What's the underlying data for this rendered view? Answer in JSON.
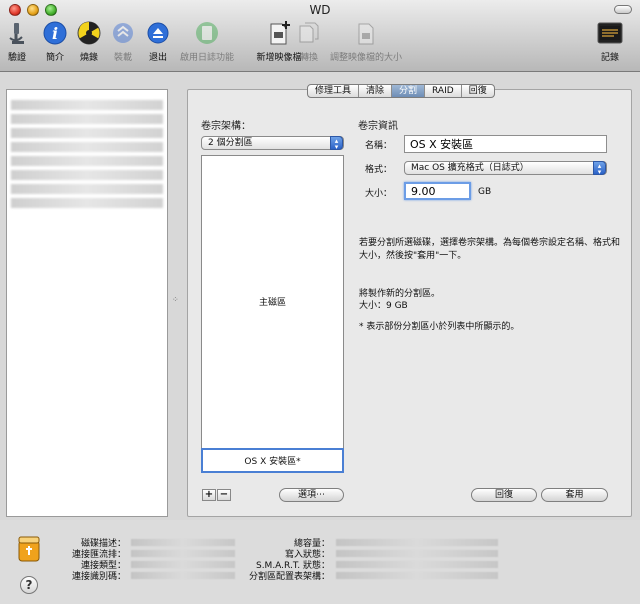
{
  "window": {
    "title": "WD"
  },
  "toolbar": {
    "items": [
      {
        "label": "驗證",
        "icon": "microscope-icon",
        "enabled": true
      },
      {
        "label": "簡介",
        "icon": "info-icon",
        "enabled": true
      },
      {
        "label": "燒錄",
        "icon": "burn-icon",
        "enabled": true
      },
      {
        "label": "裝載",
        "icon": "mount-icon",
        "enabled": false
      },
      {
        "label": "退出",
        "icon": "eject-icon",
        "enabled": true
      },
      {
        "label": "啟用日誌功能",
        "icon": "journal-icon",
        "enabled": false
      },
      {
        "label": "新增映像檔",
        "icon": "new-image-icon",
        "enabled": true
      },
      {
        "label": "轉換",
        "icon": "convert-icon",
        "enabled": false
      },
      {
        "label": "調整映像檔的大小",
        "icon": "resize-image-icon",
        "enabled": false
      }
    ],
    "log_label": "記錄"
  },
  "tabs": [
    "修理工具",
    "清除",
    "分割",
    "RAID",
    "回復"
  ],
  "active_tab": "分割",
  "volume_scheme": {
    "label": "卷宗架構：",
    "selected": "2 個分割區"
  },
  "partitions": {
    "main": "主磁區",
    "selected": "OS X 安裝區*"
  },
  "volume_info": {
    "label": "卷宗資訊",
    "name_label": "名稱：",
    "name_value": "OS X 安裝區",
    "format_label": "格式：",
    "format_value": "Mac OS 擴充格式（日誌式）",
    "size_label": "大小：",
    "size_value": "9.00",
    "size_unit": "GB"
  },
  "instructions": "若要分割所選磁碟，選擇卷宗架構。為每個卷宗設定名稱、格式和大小，然後按\"套用\"一下。",
  "new_partition": {
    "line1": "將製作新的分割區。",
    "line2": "大小：9 GB"
  },
  "note": "* 表示部份分割區小於列表中所顯示的。",
  "buttons": {
    "add": "+",
    "remove": "−",
    "options": "選項⋯",
    "revert": "回復",
    "apply": "套用"
  },
  "disk_info": {
    "left_labels": [
      "磁碟描述：",
      "連接匯流排：",
      "連接類型：",
      "連接識別碼："
    ],
    "right_labels": [
      "總容量：",
      "寫入狀態：",
      "S.M.A.R.T. 狀態：",
      "分割區配置表架構："
    ]
  },
  "colors": {
    "accent": "#4a7fd4",
    "tab_active": "#7f9cc4"
  }
}
